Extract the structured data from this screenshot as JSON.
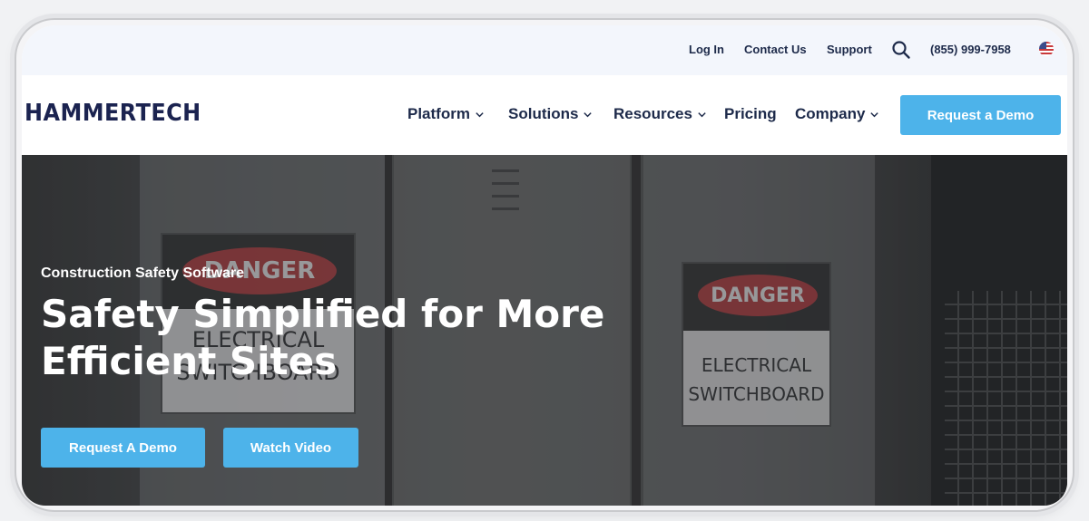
{
  "utility": {
    "login": "Log In",
    "contact": "Contact Us",
    "support": "Support",
    "phone": "(855) 999-7958"
  },
  "brand": {
    "logo": "HAMMERTECH"
  },
  "nav": {
    "items": [
      {
        "label": "Platform",
        "dropdown": true
      },
      {
        "label": "Solutions",
        "dropdown": true
      },
      {
        "label": "Resources",
        "dropdown": true
      },
      {
        "label": "Pricing",
        "dropdown": false
      },
      {
        "label": "Company",
        "dropdown": true
      }
    ],
    "cta": "Request a Demo"
  },
  "hero": {
    "eyebrow": "Construction Safety Software",
    "title": "Safety Simplified for More Efficient Sites",
    "primary_cta": "Request A Demo",
    "secondary_cta": "Watch Video",
    "sign_header": "DANGER",
    "sign_line1": "ELECTRICAL",
    "sign_line2": "SWITCHBOARD"
  },
  "colors": {
    "accent": "#4db3ea",
    "navy": "#1d2a4a",
    "utility_bg": "#f3f6fc"
  },
  "icons": {
    "search": "search-icon",
    "flag": "us-flag-icon",
    "chevron": "chevron-down-icon"
  }
}
